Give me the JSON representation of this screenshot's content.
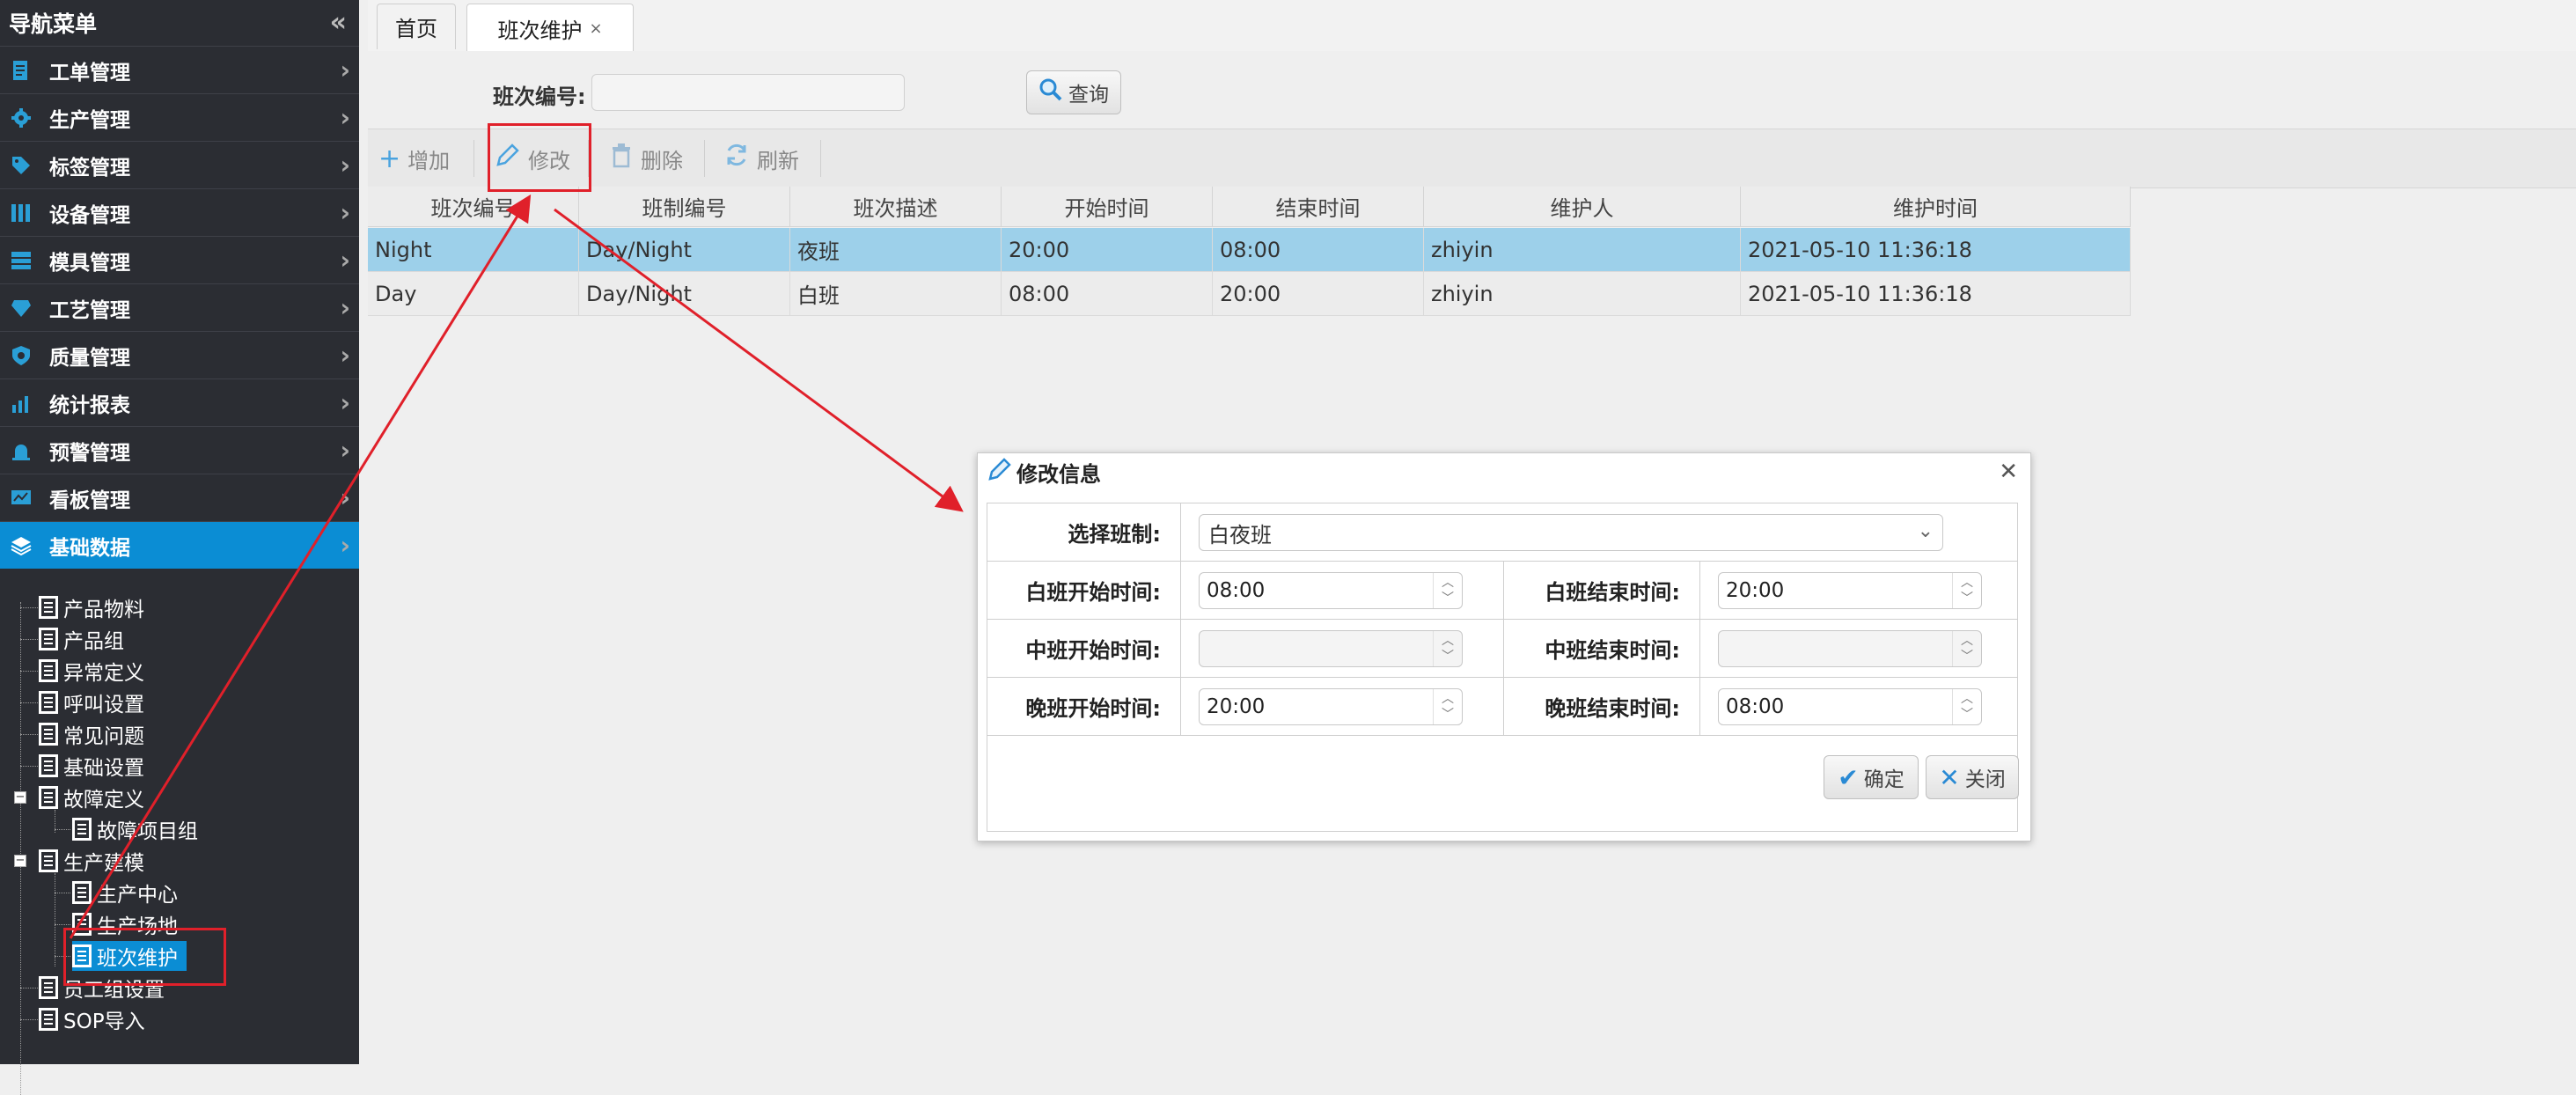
{
  "sidebar": {
    "title": "导航菜单",
    "collapse_icon": "double-chevron-left-icon",
    "items": [
      {
        "label": "工单管理",
        "icon": "document-icon"
      },
      {
        "label": "生产管理",
        "icon": "gear-icon"
      },
      {
        "label": "标签管理",
        "icon": "tag-icon"
      },
      {
        "label": "设备管理",
        "icon": "columns-icon"
      },
      {
        "label": "模具管理",
        "icon": "layers-icon"
      },
      {
        "label": "工艺管理",
        "icon": "diamond-icon"
      },
      {
        "label": "质量管理",
        "icon": "shield-icon"
      },
      {
        "label": "统计报表",
        "icon": "bar-chart-icon"
      },
      {
        "label": "预警管理",
        "icon": "alarm-icon"
      },
      {
        "label": "看板管理",
        "icon": "dashboard-icon"
      },
      {
        "label": "基础数据",
        "icon": "stack-icon",
        "active": true
      }
    ],
    "tree": [
      {
        "label": "产品物料"
      },
      {
        "label": "产品组"
      },
      {
        "label": "异常定义"
      },
      {
        "label": "呼叫设置"
      },
      {
        "label": "常见问题"
      },
      {
        "label": "基础设置"
      },
      {
        "label": "故障定义",
        "expanded": true
      },
      {
        "label": "故障项目组"
      },
      {
        "label": "生产建模",
        "expanded": true
      },
      {
        "label": "生产中心"
      },
      {
        "label": "生产场地"
      },
      {
        "label": "班次维护",
        "selected": true
      },
      {
        "label": "员工组设置"
      },
      {
        "label": "SOP导入"
      }
    ]
  },
  "tabs": [
    {
      "label": "首页"
    },
    {
      "label": "班次维护",
      "close": "×",
      "active": true
    }
  ],
  "search": {
    "label": "班次编号:",
    "value": "",
    "button": "查询"
  },
  "toolbar": {
    "add": "增加",
    "edit": "修改",
    "delete": "删除",
    "refresh": "刷新"
  },
  "grid": {
    "columns": [
      "班次编号",
      "班制编号",
      "班次描述",
      "开始时间",
      "结束时间",
      "维护人",
      "维护时间"
    ],
    "rows": [
      [
        "Night",
        "Day/Night",
        "夜班",
        "20:00",
        "08:00",
        "zhiyin",
        "2021-05-10 11:36:18"
      ],
      [
        "Day",
        "Day/Night",
        "白班",
        "08:00",
        "20:00",
        "zhiyin",
        "2021-05-10 11:36:18"
      ]
    ]
  },
  "dialog": {
    "title": "修改信息",
    "select_label": "选择班制:",
    "select_value": "白夜班",
    "day_start_label": "白班开始时间:",
    "day_start": "08:00",
    "day_end_label": "白班结束时间:",
    "day_end": "20:00",
    "mid_start_label": "中班开始时间:",
    "mid_start": "",
    "mid_end_label": "中班结束时间:",
    "mid_end": "",
    "night_start_label": "晚班开始时间:",
    "night_start": "20:00",
    "night_end_label": "晚班结束时间:",
    "night_end": "08:00",
    "ok": "确定",
    "close": "关闭"
  },
  "colors": {
    "accent": "#0b8dd4",
    "sidebar_bg": "#2b2d33",
    "selected_row": "#9dd0ea",
    "annotation": "#e0202a"
  }
}
